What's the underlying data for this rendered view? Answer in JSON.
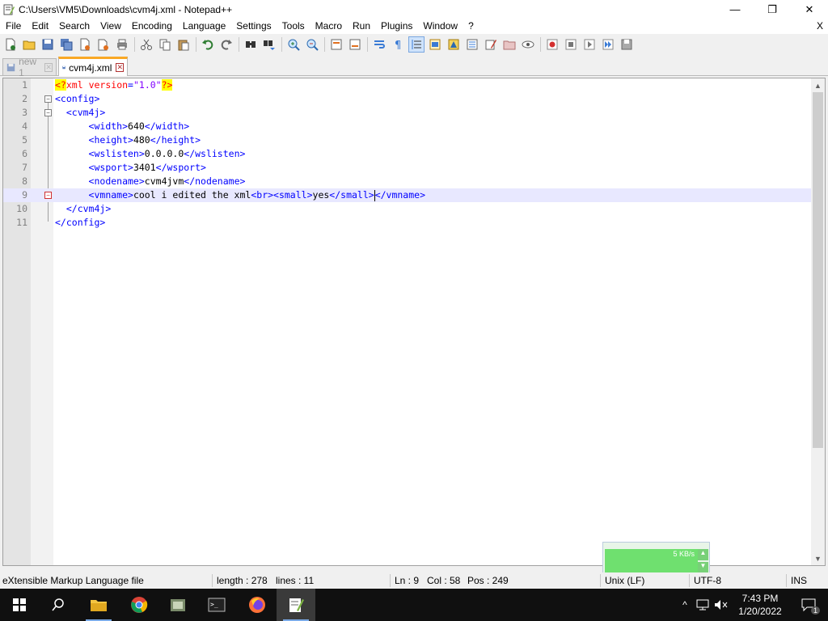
{
  "window": {
    "title": "C:\\Users\\VM5\\Downloads\\cvm4j.xml - Notepad++",
    "minimize": "—",
    "restore": "❐",
    "close": "✕"
  },
  "menu": {
    "items": [
      "File",
      "Edit",
      "Search",
      "View",
      "Encoding",
      "Language",
      "Settings",
      "Tools",
      "Macro",
      "Run",
      "Plugins",
      "Window",
      "?"
    ],
    "close_doc": "X"
  },
  "tabs": [
    {
      "label": "new 1",
      "active": false
    },
    {
      "label": "cvm4j.xml",
      "active": true
    }
  ],
  "editor": {
    "line_numbers": [
      "1",
      "2",
      "3",
      "4",
      "5",
      "6",
      "7",
      "8",
      "9",
      "10",
      "11"
    ],
    "current_line": 9
  },
  "netmeter": {
    "speed": "5 KB/s"
  },
  "status": {
    "file_type": "eXtensible Markup Language file",
    "length": "length : 278",
    "lines": "lines : 11",
    "ln": "Ln : 9",
    "col": "Col : 58",
    "pos": "Pos : 249",
    "eol": "Unix (LF)",
    "encoding": "UTF-8",
    "mode": "INS"
  },
  "taskbar": {
    "time": "7:43 PM",
    "date": "1/20/2022",
    "notifications": "1"
  },
  "colors": {
    "tag": "#0000ff",
    "attr": "#ff0000",
    "value": "#8000ff",
    "active_tab_accent": "#f9a825",
    "current_line": "#e8e8ff"
  }
}
